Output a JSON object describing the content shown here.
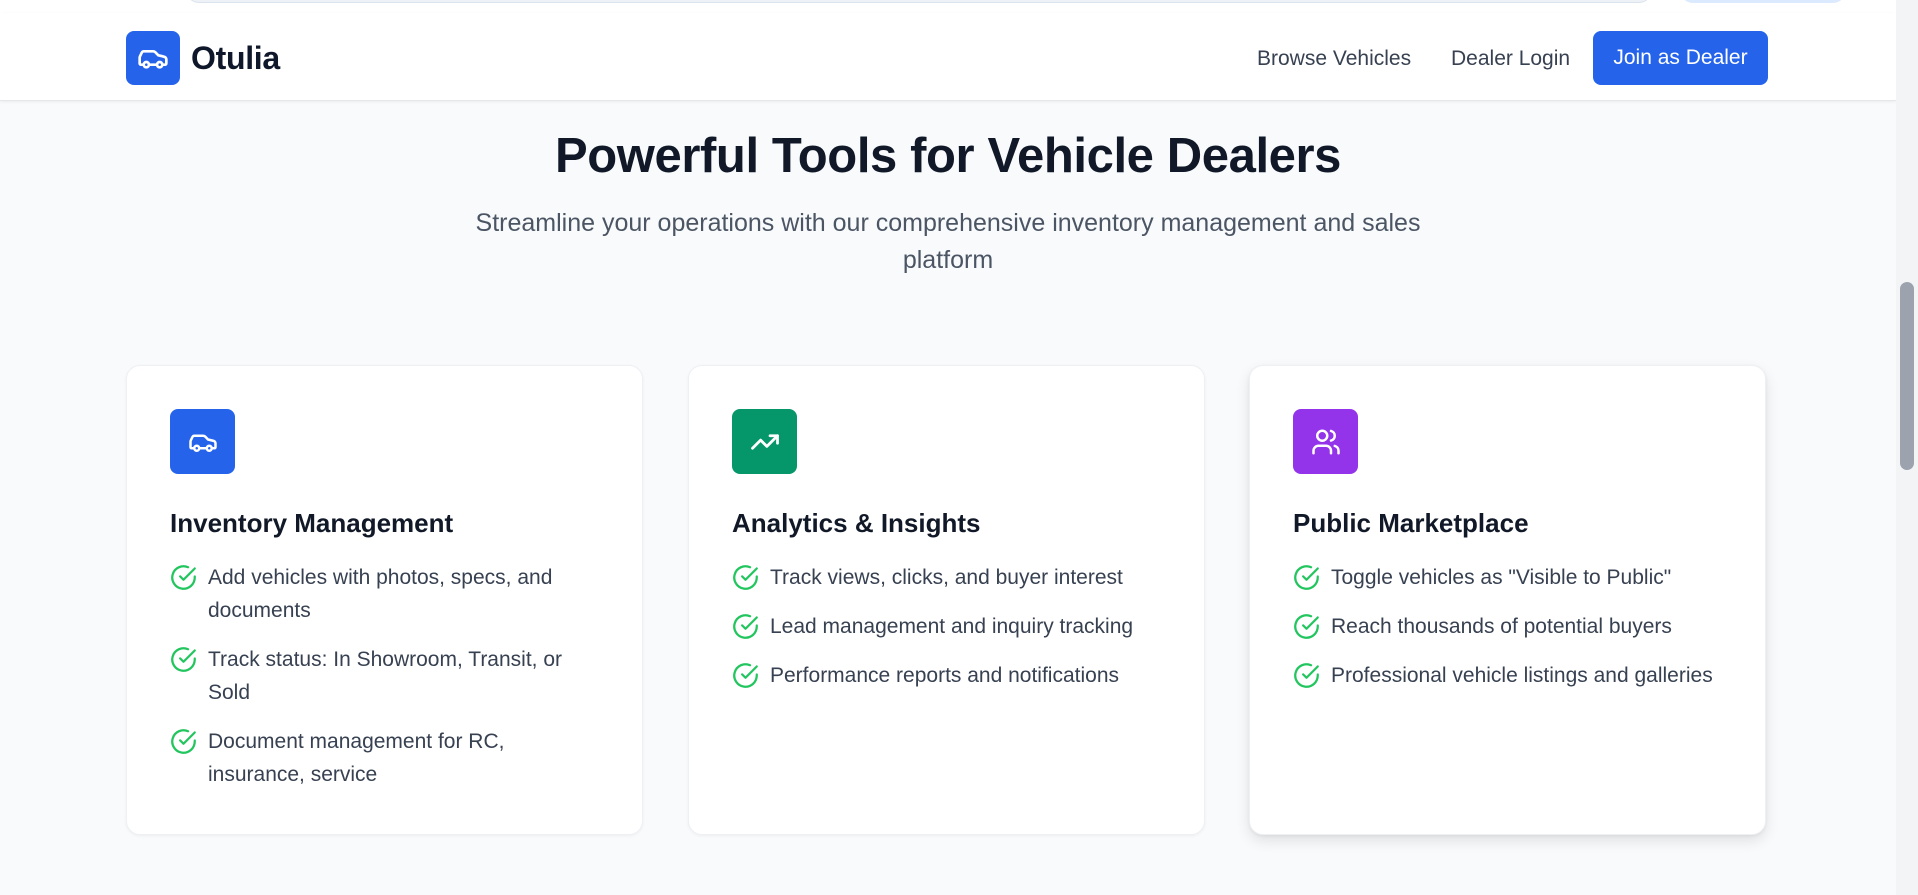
{
  "brand": {
    "name": "Otulia",
    "logo_icon": "car-icon",
    "accent": "#2563eb"
  },
  "nav": {
    "browse_label": "Browse Vehicles",
    "login_label": "Dealer Login",
    "join_label": "Join as Dealer"
  },
  "hero": {
    "title": "Powerful Tools for Vehicle Dealers",
    "subtitle": "Streamline your operations with our comprehensive inventory management and sales platform"
  },
  "features": [
    {
      "title": "Inventory Management",
      "icon": "car-icon",
      "icon_color": "#2563eb",
      "items": [
        "Add vehicles with photos, specs, and documents",
        "Track status: In Showroom, Transit, or Sold",
        "Document management for RC, insurance, service"
      ]
    },
    {
      "title": "Analytics & Insights",
      "icon": "trending-up-icon",
      "icon_color": "#059669",
      "items": [
        "Track views, clicks, and buyer interest",
        "Lead management and inquiry tracking",
        "Performance reports and notifications"
      ]
    },
    {
      "title": "Public Marketplace",
      "icon": "users-icon",
      "icon_color": "#9333ea",
      "items": [
        "Toggle vehicles as \"Visible to Public\"",
        "Reach thousands of potential buyers",
        "Professional vehicle listings and galleries"
      ]
    }
  ],
  "check_color": "#22c55e"
}
